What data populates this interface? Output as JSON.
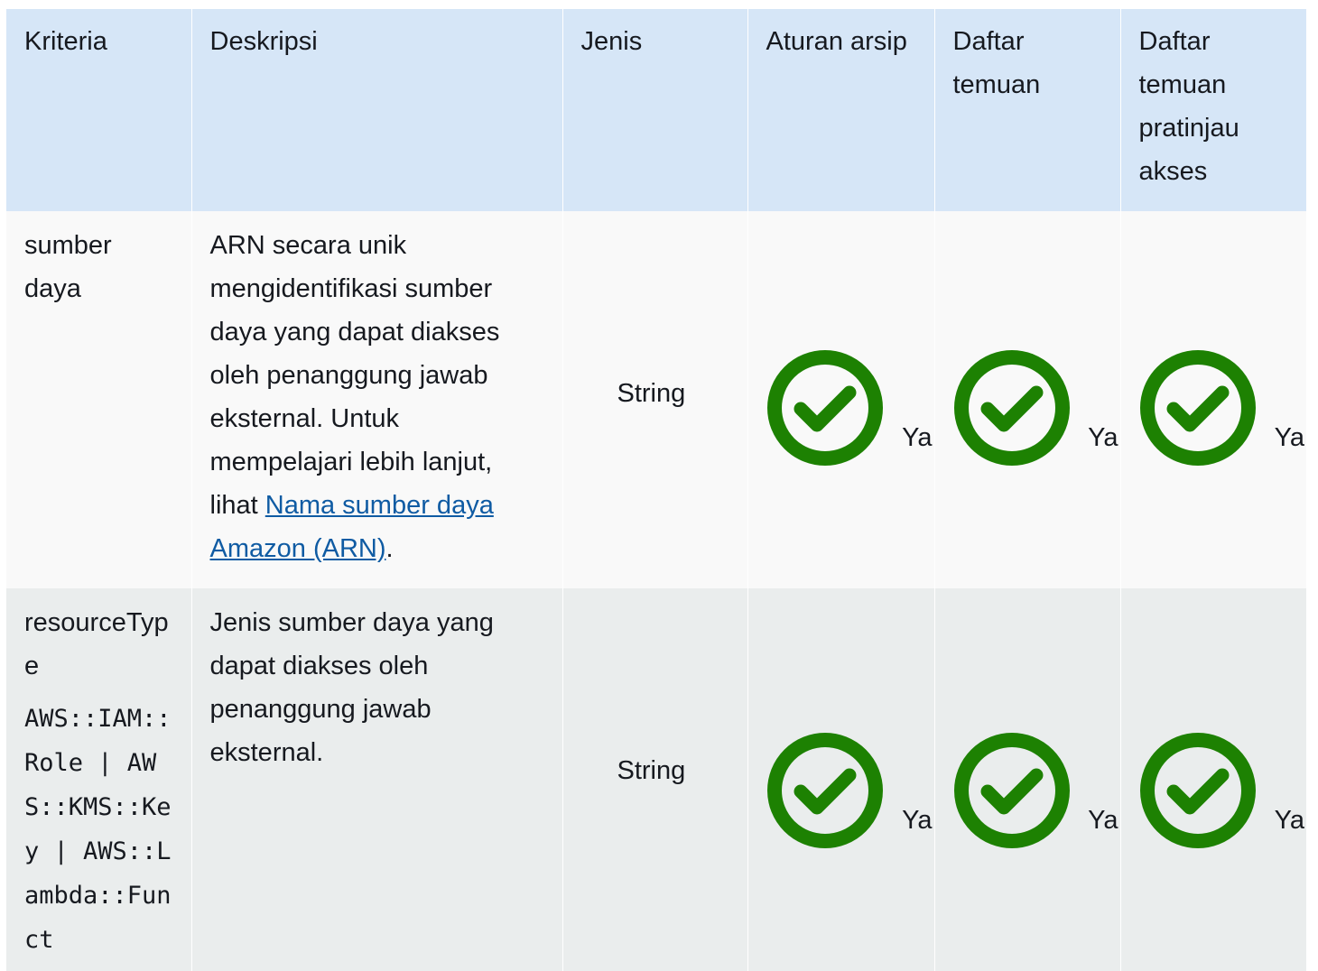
{
  "headers": [
    "Kriteria",
    "Deskripsi",
    "Jenis",
    "Aturan arsip",
    "Daftar temuan",
    "Daftar temuan pratinjau akses"
  ],
  "rows": [
    {
      "criteria": "sumber daya",
      "description_text": "ARN secara unik mengidentifikasi sumber daya yang dapat diakses oleh penanggung jawab eksternal. Untuk mempelajari lebih lanjut, lihat ",
      "description_link": "Nama sumber daya Amazon (ARN)",
      "description_tail": ".",
      "type": "String",
      "checks": [
        "Ya",
        "Ya",
        "Ya"
      ]
    },
    {
      "criteria": "resourceType",
      "criteria_code": "AWS::IAM::Role | AWS::KMS::Key | AWS::Lambda::Funct",
      "description_text": "Jenis sumber daya yang dapat diakses oleh penanggung jawab eksternal.",
      "type": "String",
      "checks": [
        "Ya",
        "Ya",
        "Ya"
      ]
    }
  ],
  "colors": {
    "header_bg": "#d6e6f7",
    "row1_bg": "#f9f9f9",
    "row2_bg": "#eaeded",
    "check_green": "#1d8102",
    "link": "#0f5ba3"
  },
  "icons": {
    "check": "check-circle-icon"
  }
}
